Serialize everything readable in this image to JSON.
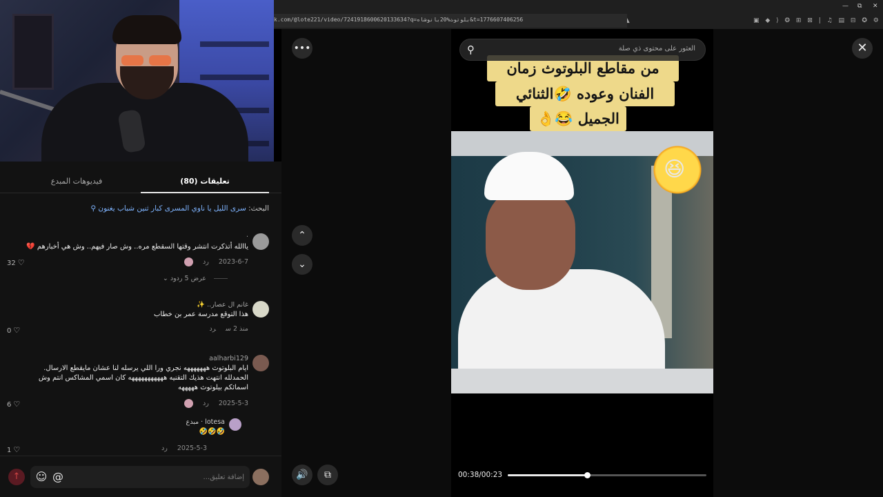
{
  "browser": {
    "url": "k.com/@lote221/video/7241918600620133634?q=بلوتوث%20بانوشاه&t=1776607406256",
    "window_controls": [
      "—",
      "⧉",
      "✕"
    ],
    "icons": [
      "search-icon",
      "translate-icon",
      "share-icon",
      "brave-icon",
      "extension-icon",
      "media-icon",
      "sidebar-icon",
      "menu-icon"
    ]
  },
  "left_panel": {
    "tabs": [
      {
        "label": "فيديوهات المبدع",
        "active": false
      },
      {
        "label": "(80) تعليقات",
        "active": true
      }
    ],
    "search_prefix": "البحث: ",
    "search_query": "سرى الليل يا ناوي المسرى كبار ثنين شباب يغنون",
    "comments": [
      {
        "name": "·",
        "text": "ياالله أتذكرت انتشر وقتها السقطع مره.. وش صار فيهم.. وش هي أخبارهم 💔",
        "date": "2023-6-7",
        "reply": "رد",
        "likes": "32",
        "replies_label": "عرض 5 ردود"
      },
      {
        "name": "غانم ال عصار.. ✨",
        "text": "هذا التوقع مدرسة عمر بن خطاب",
        "date": "منذ 2 س",
        "reply": "رد",
        "likes": "0"
      },
      {
        "name": "aalharbi129",
        "text": "ايام البلوتوث هههههههه نجري ورا اللي يرسله لنا عشان مايقطع الارسال. الحمدلله انتهت هذيك التقنيه هههههههههههه كان اسمي المشاكس انتم وش اسمائكم بيلوتوث هههههه",
        "date": "2025-5-3",
        "reply": "رد",
        "likes": "6"
      },
      {
        "name": "lotesa · مبدع",
        "text": "🤣🤣🤣",
        "date": "2025-5-3",
        "reply": "رد",
        "likes": "1"
      }
    ],
    "composer_placeholder": "إضافة تعليق...",
    "composer_icons": [
      "emoji-icon",
      "mention-icon"
    ]
  },
  "viewer": {
    "search_placeholder": "العثور على محتوى ذي صلة",
    "caption_lines": [
      "من مقاطع البلوتوث زمان",
      "الفنان وعوده 🤣الثنائي",
      "الجميل 😂👌"
    ],
    "time": "00:38/00:23",
    "progress": 0.4,
    "buttons": {
      "more": "•••",
      "up": "⌃",
      "down": "⌄",
      "close": "✕",
      "volume": "🔊",
      "pip": "⧉"
    }
  },
  "colors": {
    "panel_bg": "#121212",
    "accent_link": "#7fb4ff",
    "caption_bg": "#eed98a"
  }
}
